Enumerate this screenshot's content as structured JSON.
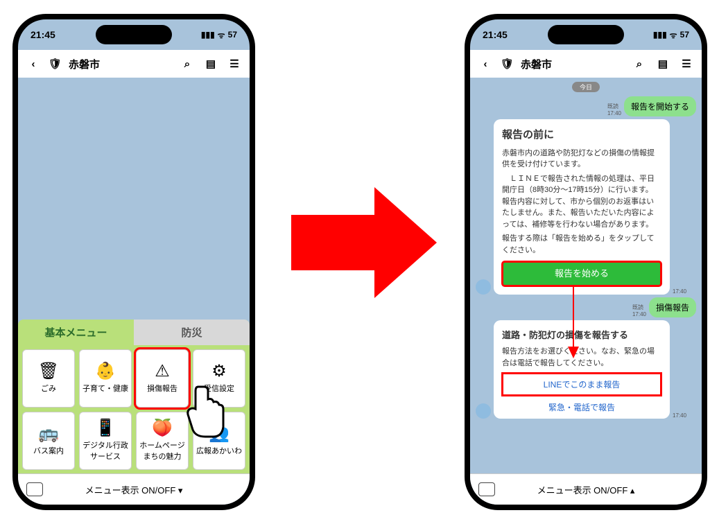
{
  "statusbar": {
    "time": "21:45",
    "battery": "57"
  },
  "header": {
    "title": "赤磐市"
  },
  "left": {
    "tabs": {
      "basic": "基本メニュー",
      "bosai": "防災"
    },
    "cells": [
      {
        "icon": "🗑",
        "label": "ごみ"
      },
      {
        "icon": "👶",
        "label": "子育て・健康"
      },
      {
        "icon": "⚠",
        "label": "損傷報告"
      },
      {
        "icon": "⚙",
        "label": "受信設定"
      },
      {
        "icon": "🚌",
        "label": "バス案内"
      },
      {
        "icon": "📱",
        "label": "デジタル行政\nサービス"
      },
      {
        "icon": "🍑",
        "label": "ホームページ\nまちの魅力"
      },
      {
        "icon": "👥",
        "label": "広報あかいわ"
      }
    ],
    "footer": "メニュー表示 ON/OFF ▾"
  },
  "right": {
    "date": "今日",
    "read": "既読",
    "me1": "報告を開始する",
    "me2": "損傷報告",
    "ts1": "17:40",
    "ts2": "17:40",
    "ts3": "17:40",
    "ts4": "17:40",
    "card1": {
      "title": "報告の前に",
      "p1": "赤磐市内の道路や防犯灯などの損傷の情報提供を受け付けています。",
      "p2": "　ＬＩＮＥで報告された情報の処理は、平日開庁日（8時30分～17時15分）に行います。　報告内容に対して、市から個別のお返事はいたしません。また、報告いただいた内容によっては、補修等を行わない場合があります。",
      "p3": "報告する際は「報告を始める」をタップしてください。",
      "btn": "報告を始める"
    },
    "card2": {
      "title": "道路・防犯灯の損傷を報告する",
      "p1": "報告方法をお選びください。なお、緊急の場合は電話で報告してください。",
      "opt1": "LINEでこのまま報告",
      "opt2": "緊急・電話で報告"
    },
    "footer": "メニュー表示 ON/OFF ▴"
  }
}
